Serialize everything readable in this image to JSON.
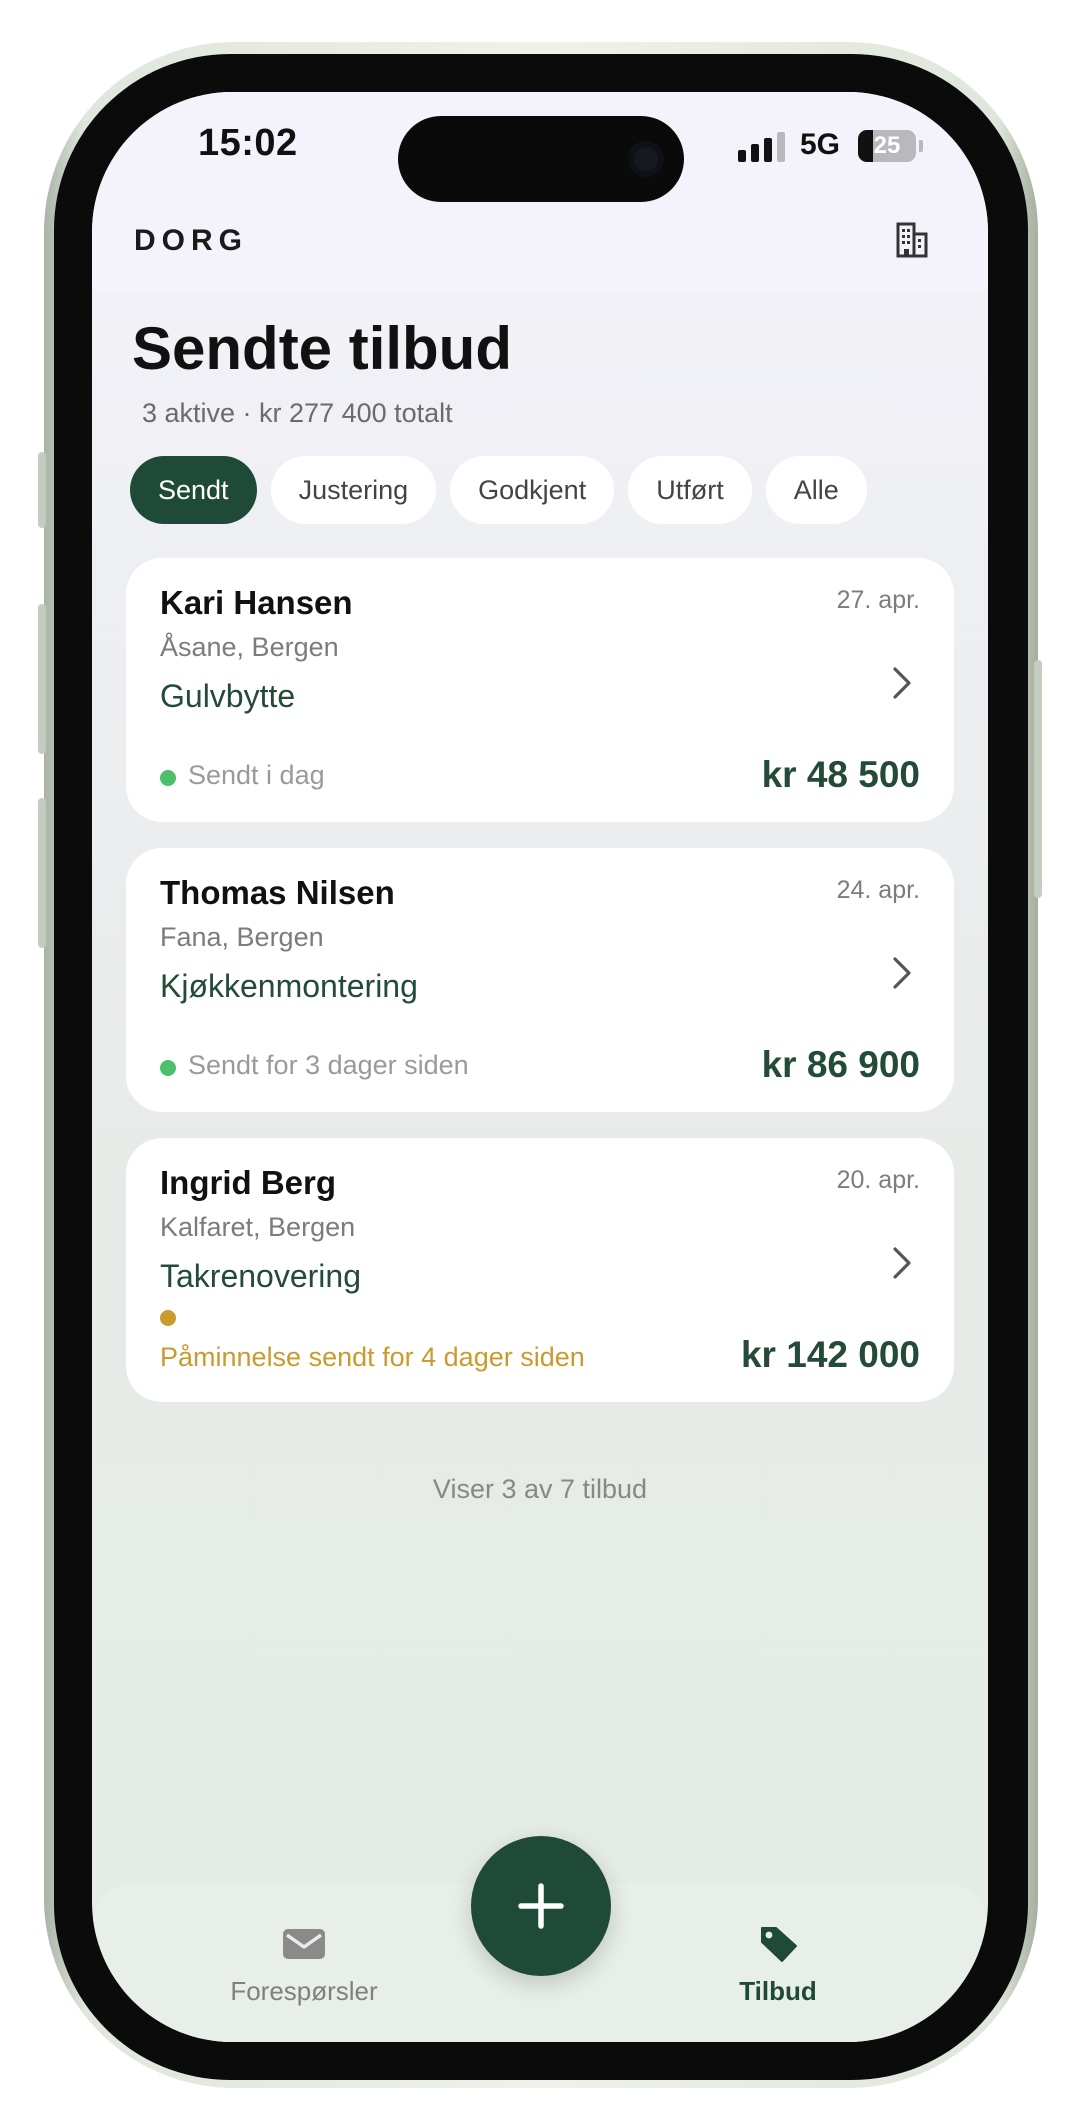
{
  "status_bar": {
    "time": "15:02",
    "network": "5G",
    "battery_level": "25",
    "battery_fraction": 0.25
  },
  "header": {
    "brand": "DORG",
    "building_icon": "building-icon"
  },
  "page": {
    "title": "Sendte tilbud",
    "subtitle": "3 aktive · kr 277 400 totalt"
  },
  "filters": [
    {
      "label": "Sendt",
      "active": true
    },
    {
      "label": "Justering",
      "active": false
    },
    {
      "label": "Godkjent",
      "active": false
    },
    {
      "label": "Utført",
      "active": false
    },
    {
      "label": "Alle",
      "active": false
    }
  ],
  "offers": [
    {
      "name": "Kari Hansen",
      "location": "Åsane, Bergen",
      "job": "Gulvbytte",
      "date": "27. apr.",
      "status": "Sendt i dag",
      "status_color": "#4cc06a",
      "amount": "kr 48 500"
    },
    {
      "name": "Thomas Nilsen",
      "location": "Fana, Bergen",
      "job": "Kjøkkenmontering",
      "date": "24. apr.",
      "status": "Sendt for 3 dager siden",
      "status_color": "#4cc06a",
      "amount": "kr 86 900"
    },
    {
      "name": "Ingrid Berg",
      "location": "Kalfaret, Bergen",
      "job": "Takrenovering",
      "date": "20. apr.",
      "status": "Påminnelse sendt for 4 dager siden",
      "status_color": "#c99a2e",
      "amount": "kr 142 000"
    }
  ],
  "footer_note": "Viser 3 av 7 tilbud",
  "tabbar": {
    "left_label": "Forespørsler",
    "left_icon": "envelope-icon",
    "right_label": "Tilbud",
    "right_icon": "tag-icon",
    "fab_icon": "plus-icon"
  },
  "colors": {
    "accent": "#1f4a37",
    "success": "#4cc06a",
    "warning": "#c99a2e"
  }
}
